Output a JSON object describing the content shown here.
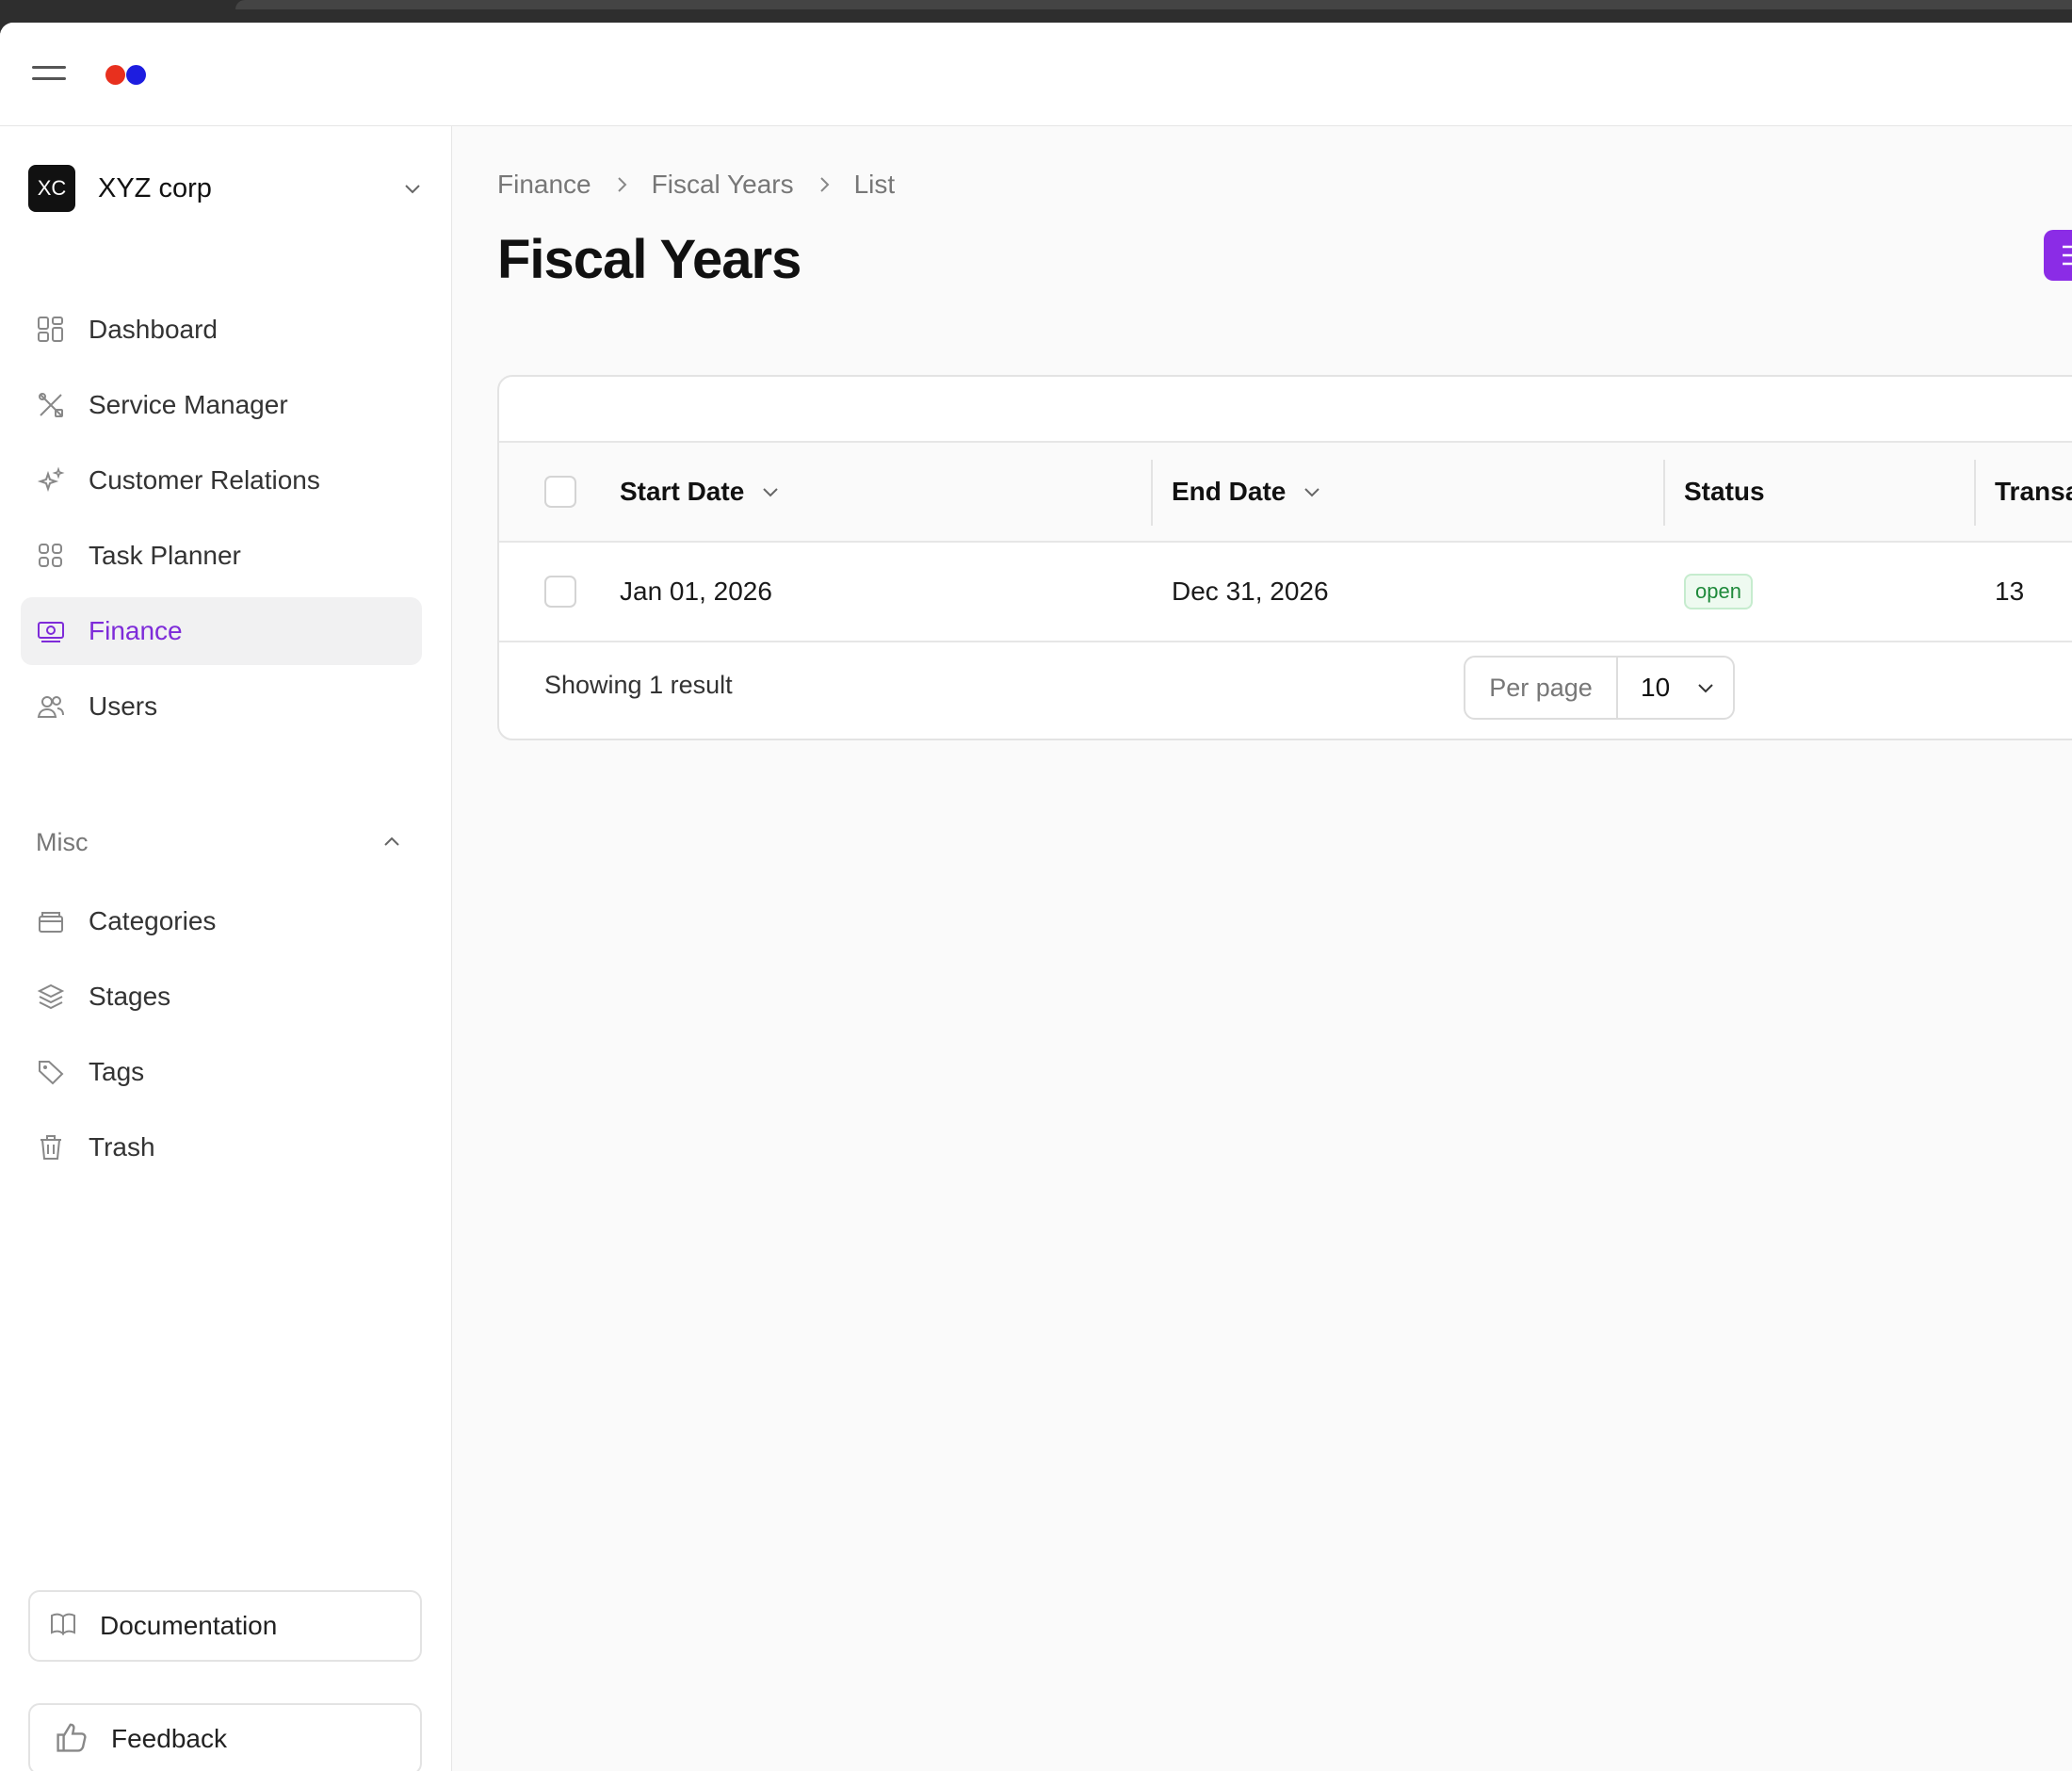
{
  "header": {
    "logo_colors": [
      "#e8301e",
      "#1d1de0"
    ]
  },
  "sidebar": {
    "org": {
      "initials": "XC",
      "name": "XYZ corp"
    },
    "items": [
      {
        "label": "Dashboard",
        "icon": "dashboard-icon",
        "active": false
      },
      {
        "label": "Service Manager",
        "icon": "tools-icon",
        "active": false
      },
      {
        "label": "Customer Relations",
        "icon": "sparkles-icon",
        "active": false
      },
      {
        "label": "Task Planner",
        "icon": "grid-icon",
        "active": false
      },
      {
        "label": "Finance",
        "icon": "banknote-icon",
        "active": true
      },
      {
        "label": "Users",
        "icon": "users-icon",
        "active": false
      }
    ],
    "misc_label": "Misc",
    "misc_items": [
      {
        "label": "Categories",
        "icon": "archive-icon"
      },
      {
        "label": "Stages",
        "icon": "layers-icon"
      },
      {
        "label": "Tags",
        "icon": "tag-icon"
      },
      {
        "label": "Trash",
        "icon": "trash-icon"
      }
    ],
    "documentation_label": "Documentation",
    "feedback_label": "Feedback"
  },
  "breadcrumb": [
    "Finance",
    "Fiscal Years",
    "List"
  ],
  "page_title": "Fiscal Years",
  "colors": {
    "accent": "#8b2ce6",
    "active_text": "#7e2bd9",
    "status_open": "#1f8a3b"
  },
  "table": {
    "columns": [
      "Start Date",
      "End Date",
      "Status",
      "Transa"
    ],
    "rows": [
      {
        "start_date": "Jan 01, 2026",
        "end_date": "Dec 31, 2026",
        "status": "open",
        "transactions": "13"
      }
    ],
    "result_text": "Showing 1 result",
    "per_page_label": "Per page",
    "per_page_value": "10"
  }
}
